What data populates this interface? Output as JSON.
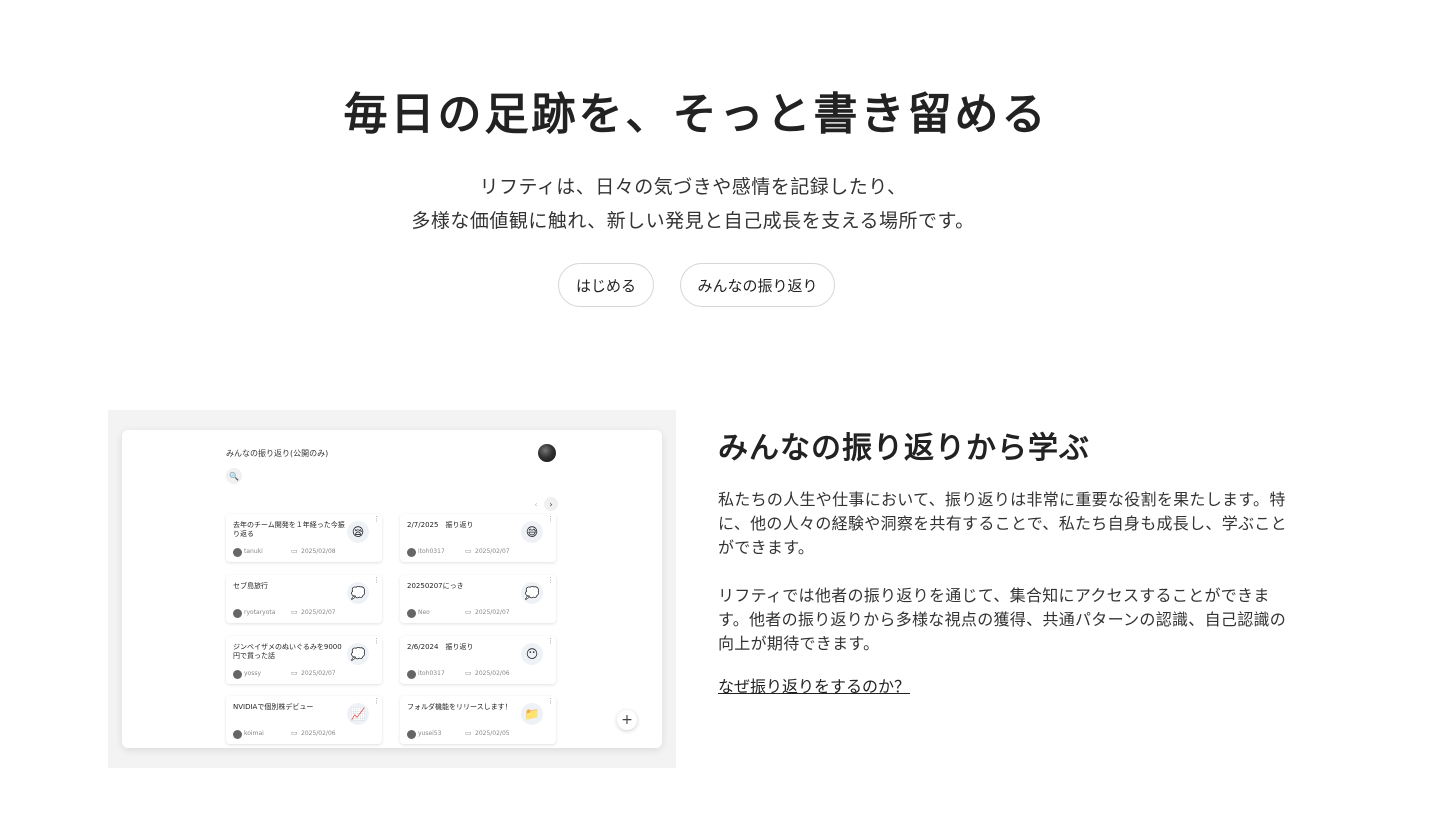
{
  "hero": {
    "title": "毎日の足跡を、そっと書き留める",
    "subtitle_line1": "リフティは、日々の気づきや感情を記録したり、",
    "subtitle_line2": "多様な価値観に触れ、新しい発見と自己成長を支える場所です。",
    "start_button": "はじめる",
    "everyone_button": "みんなの振り返り"
  },
  "preview": {
    "title": "みんなの振り返り(公開のみ)",
    "prev": "‹",
    "next": "›",
    "search_icon": "🔍",
    "add_icon": "+",
    "entries": [
      {
        "title": "去年のチーム開発を１年経った今振り返る",
        "user": "tanuki",
        "date": "2025/02/08",
        "emoji": "😪"
      },
      {
        "title": "2/7/2025　振り返り",
        "user": "itoh0317",
        "date": "2025/02/07",
        "emoji": "😅"
      },
      {
        "title": "セブ島旅行",
        "user": "ryotaryota",
        "date": "2025/02/07",
        "emoji": "💭"
      },
      {
        "title": "20250207にっき",
        "user": "Neo",
        "date": "2025/02/07",
        "emoji": "💭"
      },
      {
        "title": "ジンベイザメのぬいぐるみを9000円で買った話",
        "user": "yossy",
        "date": "2025/02/07",
        "emoji": "💭"
      },
      {
        "title": "2/6/2024　振り返り",
        "user": "itoh0317",
        "date": "2025/02/06",
        "emoji": "😶"
      },
      {
        "title": "NVIDIAで個別株デビュー",
        "user": "koimai",
        "date": "2025/02/06",
        "emoji": "📈"
      },
      {
        "title": "フォルダ機能をリリースします！",
        "user": "yusei53",
        "date": "2025/02/05",
        "emoji": "📁"
      }
    ]
  },
  "section": {
    "title": "みんなの振り返りから学ぶ",
    "paragraph1": "私たちの人生や仕事において、振り返りは非常に重要な役割を果たします。特に、他の人々の経験や洞察を共有することで、私たち自身も成長し、学ぶことができます。",
    "paragraph2": "リフティでは他者の振り返りを通じて、集合知にアクセスすることができます。他者の振り返りから多様な視点の獲得、共通パターンの認識、自己認識の向上が期待できます。",
    "link": "なぜ振り返りをするのか？"
  }
}
